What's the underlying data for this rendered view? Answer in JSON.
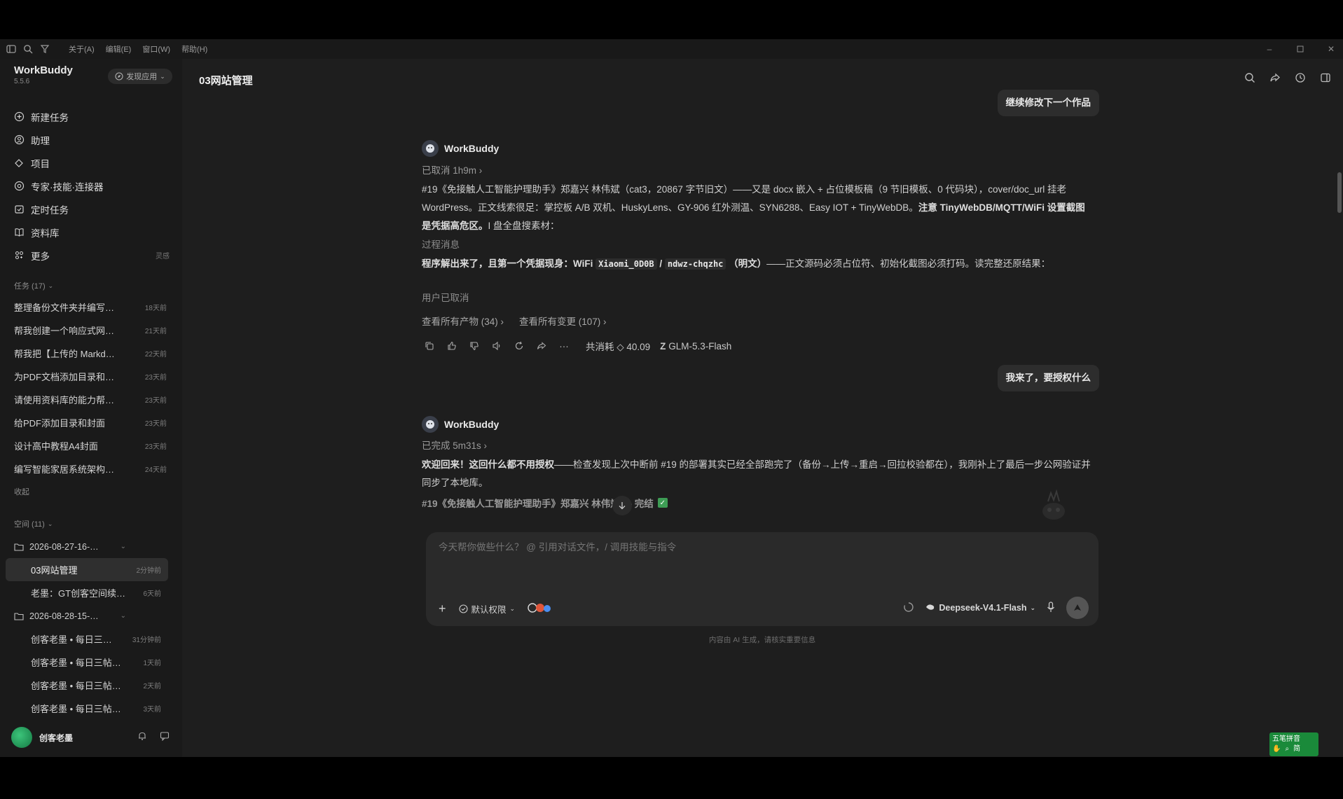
{
  "menubar": {
    "menus": [
      "关于(A)",
      "编辑(E)",
      "窗口(W)",
      "帮助(H)"
    ]
  },
  "sidebar": {
    "brand": "WorkBuddy",
    "version": "5.5.6",
    "discover_label": "发现应用",
    "nav": [
      {
        "label": "新建任务",
        "icon": "plus-circle-icon"
      },
      {
        "label": "助理",
        "icon": "assistant-icon"
      },
      {
        "label": "项目",
        "icon": "project-icon"
      },
      {
        "label": "专家·技能·连接器",
        "icon": "expert-icon"
      },
      {
        "label": "定时任务",
        "icon": "schedule-icon"
      },
      {
        "label": "资料库",
        "icon": "book-icon"
      },
      {
        "label": "更多",
        "icon": "more-icon",
        "trail": "灵感"
      }
    ],
    "tasks_header": "任务 (17)",
    "tasks": [
      {
        "title": "整理备份文件夹并编写…",
        "time": "18天前"
      },
      {
        "title": "帮我创建一个响应式网…",
        "time": "21天前"
      },
      {
        "title": "帮我把【上传的 Markd…",
        "time": "22天前"
      },
      {
        "title": "为PDF文档添加目录和…",
        "time": "23天前"
      },
      {
        "title": "请使用资料库的能力帮…",
        "time": "23天前"
      },
      {
        "title": "给PDF添加目录和封面",
        "time": "23天前"
      },
      {
        "title": "设计高中教程A4封面",
        "time": "23天前"
      },
      {
        "title": "编写智能家居系统架构…",
        "time": "24天前"
      }
    ],
    "collapse_label": "收起",
    "spaces_header": "空间 (11)",
    "spaces": [
      {
        "folder": "2026-08-27-16-…",
        "items": [
          {
            "title": "03网站管理",
            "time": "2分钟前",
            "active": true
          },
          {
            "title": "老墨：GT创客空间续…",
            "time": "6天前"
          }
        ]
      },
      {
        "folder": "2026-08-28-15-…",
        "items": [
          {
            "title": "创客老墨 • 每日三…",
            "time": "31分钟前"
          },
          {
            "title": "创客老墨 • 每日三帖…",
            "time": "1天前"
          },
          {
            "title": "创客老墨 • 每日三帖…",
            "time": "2天前"
          },
          {
            "title": "创客老墨 • 每日三帖…",
            "time": "3天前"
          }
        ]
      }
    ],
    "user_name": "创客老墨"
  },
  "main": {
    "title": "03网站管理",
    "user_msg_1": "继续修改下一个作品",
    "agent_name": "WorkBuddy",
    "turn1_status": "已取消 1h9m",
    "turn1_para1_bold": "#19《免接触人工智能护理助手》郑嘉兴 林伟斌（cat3，20867 字节旧文）——又是 docx 嵌入 + 占位模板稿（9 节旧模板、0 代码块），cover/doc_url 挂老 WordPress。正文线索很足：掌控板 A/B 双机、HuskyLens、GY-906 红外测温、SYN6288、Easy IOT + TinyWebDB。",
    "turn1_para1_strong": "注意 TinyWebDB/MQTT/WiFi 设置截图是凭据高危区。",
    "turn1_para1_tail": "I 盘全盘搜素材：",
    "turn1_process": "过程消息",
    "turn1_para2_a": "程序解出来了，且第一个凭据现身：WiFi",
    "turn1_code1": "Xiaomi_0D0B",
    "turn1_sep": "/",
    "turn1_code2": "ndwz-chqzhc",
    "turn1_para2_b": "（明文）",
    "turn1_para2_c": "——正文源码必须占位符、初始化截图必须打码。读完整还原结果：",
    "turn1_cancelled": "用户已取消",
    "link_artifacts": "查看所有产物 (34)",
    "link_changes": "查看所有变更 (107)",
    "cost_label": "共消耗 ◇ 40.09",
    "model_used": "GLM-5.3-Flash",
    "user_msg_2": "我来了，要授权什么",
    "turn2_status": "已完成 5m31s",
    "turn2_para_a": "欢迎回来！",
    "turn2_para_b": "这回什么都不用授权",
    "turn2_para_c": "——检查发现上次中断前 #19 的部署其实已经全部跑完了（备份→上传→重启→回拉校验都在），我刚补上了最后一步公网验证并同步了本地库。",
    "turn2_progress": "#19《免接触人工智能护理助手》郑嘉兴 林伟斌 — 完结"
  },
  "composer": {
    "placeholder": "今天帮你做些什么？ @ 引用对话文件，/ 调用技能与指令",
    "permission": "默认权限",
    "model": "Deepseek-V4.1-Flash",
    "disclaimer": "内容由 AI 生成，请核实重要信息"
  },
  "ime": {
    "line1": "五笔拼音",
    "line2": "简"
  }
}
